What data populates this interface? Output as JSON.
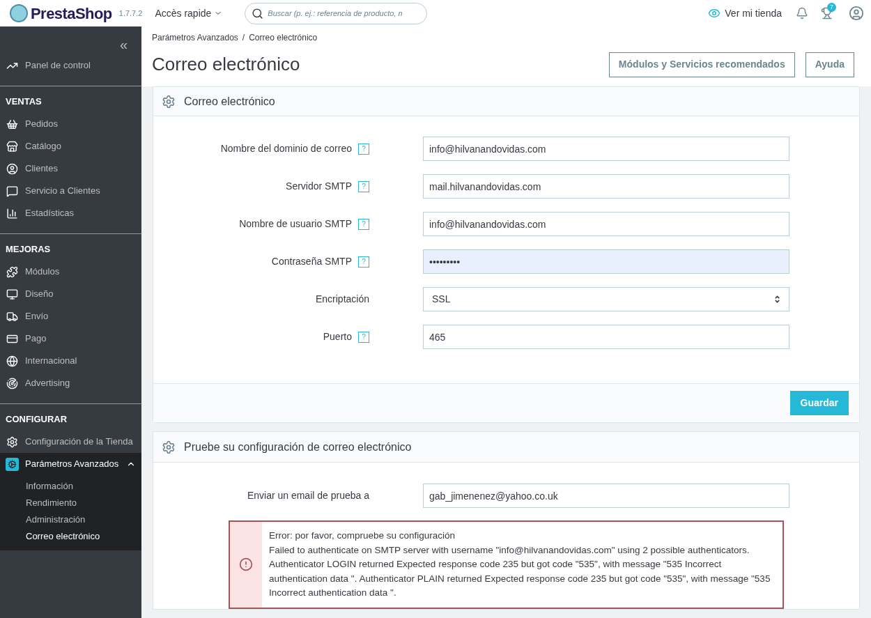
{
  "header": {
    "logo": "PrestaShop",
    "version": "1.7.7.2",
    "quick_access": "Accès rapide",
    "search": {
      "placeholder": "Buscar (p. ej.: referencia de producto, n"
    },
    "view_store": "Ver mi tienda",
    "notifications_badge": "7"
  },
  "sidebar": {
    "collapse": "«",
    "sections": [
      {
        "items": [
          {
            "label": "Panel de control",
            "selected": false,
            "expanded": false
          }
        ]
      },
      {
        "title": "VENTAS",
        "items": [
          {
            "label": "Pedidos",
            "selected": false,
            "expanded": false
          },
          {
            "label": "Catálogo",
            "selected": false,
            "expanded": false
          },
          {
            "label": "Clientes",
            "selected": false,
            "expanded": false
          },
          {
            "label": "Servicio a Clientes",
            "selected": false,
            "expanded": false
          },
          {
            "label": "Estadísticas",
            "selected": false,
            "expanded": false
          }
        ]
      },
      {
        "title": "MEJORAS",
        "items": [
          {
            "label": "Módulos",
            "selected": false,
            "expanded": false
          },
          {
            "label": "Diseño",
            "selected": false,
            "expanded": false
          },
          {
            "label": "Envío",
            "selected": false,
            "expanded": false
          },
          {
            "label": "Pago",
            "selected": false,
            "expanded": false
          },
          {
            "label": "Internacional",
            "selected": false,
            "expanded": false
          },
          {
            "label": "Advertising",
            "selected": false,
            "expanded": false
          }
        ]
      },
      {
        "title": "CONFIGURAR",
        "items": [
          {
            "label": "Configuración de la Tienda",
            "selected": false,
            "expanded": false
          },
          {
            "label": "Parámetros Avanzados",
            "selected": true,
            "expanded": true,
            "children": [
              {
                "label": "Información",
                "selected": false
              },
              {
                "label": "Rendimiento",
                "selected": false
              },
              {
                "label": "Administración",
                "selected": false
              },
              {
                "label": "Correo electrónico",
                "selected": true
              }
            ]
          }
        ]
      }
    ]
  },
  "breadcrumb": [
    "Parámetros Avanzados",
    "Correo electrónico"
  ],
  "breadcrumb_separator": "/",
  "page_title": "Correo electrónico",
  "toolbar_buttons": [
    "Módulos y Servicios recomendados",
    "Ayuda"
  ],
  "email_panel": {
    "title": "Correo electrónico",
    "fields": [
      {
        "kind": "text",
        "label": "Nombre del dominio de correo",
        "help": "?",
        "value": "info@hilvanandovidas.com"
      },
      {
        "kind": "text",
        "label": "Servidor SMTP",
        "help": "?",
        "value": "mail.hilvanandovidas.com"
      },
      {
        "kind": "text",
        "label": "Nombre de usuario SMTP",
        "help": "?",
        "value": "info@hilvanandovidas.com"
      },
      {
        "kind": "password",
        "label": "Contraseña SMTP",
        "help": "?",
        "value": "•••••••••"
      },
      {
        "kind": "select",
        "label": "Encriptación",
        "value": "SSL"
      },
      {
        "kind": "text",
        "label": "Puerto",
        "help": "?",
        "value": "465"
      }
    ],
    "save_button": "Guardar"
  },
  "test_panel": {
    "title": "Pruebe su configuración de correo electrónico",
    "fields": [
      {
        "kind": "text",
        "label": "Enviar un email de prueba a",
        "value": "gab_jimenenez@yahoo.co.uk"
      }
    ],
    "error": {
      "title": "Error: por favor, compruebe su configuración",
      "message": "Failed to authenticate on SMTP server with username \"info@hilvanandovidas.com\" using 2 possible authenticators. Authenticator LOGIN returned Expected response code 235 but got code \"535\", with message \"535 Incorrect authentication data \". Authenticator PLAIN returned Expected response code 235 but got code \"535\", with message \"535 Incorrect authentication data \"."
    }
  }
}
